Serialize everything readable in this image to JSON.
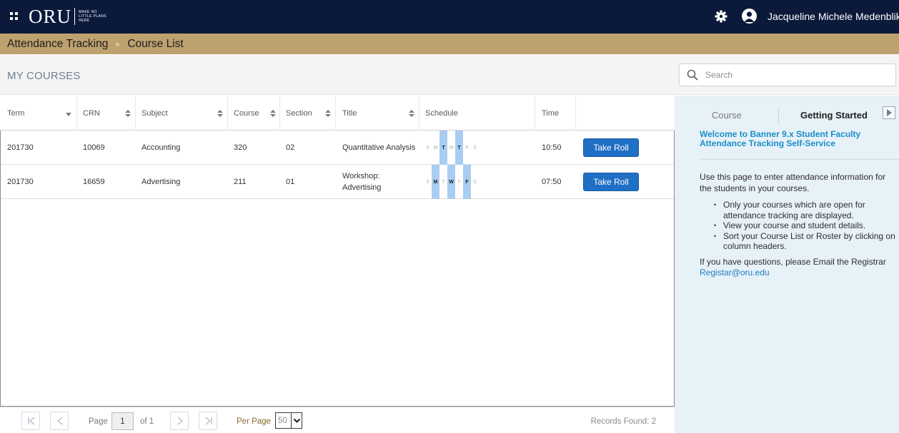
{
  "header": {
    "logo_text": "ORU",
    "logo_tagline": "MAKE NO LITTLE PLANS HERE",
    "user_name": "Jacqueline Michele Medenblik"
  },
  "breadcrumb": {
    "items": [
      "Attendance Tracking",
      "Course List"
    ]
  },
  "main": {
    "title": "MY COURSES"
  },
  "search": {
    "placeholder": "Search"
  },
  "table": {
    "columns": [
      "Term",
      "CRN",
      "Subject",
      "Course",
      "Section",
      "Title",
      "Schedule",
      "Time"
    ],
    "rows": [
      {
        "term": "201730",
        "crn": "10069",
        "subject": "Accounting",
        "course": "320",
        "section": "02",
        "title": "Quantitative Analysis",
        "time": "10:50",
        "action": "Take Roll",
        "days": [
          {
            "label": "S",
            "on": false
          },
          {
            "label": "M",
            "on": false
          },
          {
            "label": "T",
            "on": true
          },
          {
            "label": "W",
            "on": false
          },
          {
            "label": "T",
            "on": true
          },
          {
            "label": "F",
            "on": false
          },
          {
            "label": "S",
            "on": false
          }
        ]
      },
      {
        "term": "201730",
        "crn": "16659",
        "subject": "Advertising",
        "course": "211",
        "section": "01",
        "title_line1": "Workshop:",
        "title_line2": "Advertising",
        "time": "07:50",
        "action": "Take Roll",
        "days": [
          {
            "label": "S",
            "on": false
          },
          {
            "label": "M",
            "on": true
          },
          {
            "label": "T",
            "on": false
          },
          {
            "label": "W",
            "on": true
          },
          {
            "label": "T",
            "on": false
          },
          {
            "label": "F",
            "on": true
          },
          {
            "label": "S",
            "on": false
          }
        ]
      }
    ]
  },
  "pagination": {
    "page_label": "Page",
    "page_value": "1",
    "of_label": "of 1",
    "per_page_label": "Per Page",
    "per_page_value": "50",
    "records_found": "Records Found: 2"
  },
  "side_panel": {
    "tabs": [
      "Course",
      "Getting Started"
    ],
    "welcome": "Welcome to Banner 9.x Student Faculty Attendance Tracking Self-Service",
    "intro": "Use this page to enter attendance information for the students in your courses.",
    "bullets": [
      "Only your courses which are open for attendance tracking are displayed.",
      "View your course and student details.",
      "Sort your Course List or Roster by clicking on column headers."
    ],
    "question": "If you have questions, please Email the Registrar",
    "email": "Registar@oru.edu"
  },
  "colors": {
    "topbar": "#0b1a3b",
    "breadcrumb": "#bda16e",
    "button": "#1f6fc5",
    "schedule_highlight": "#a9cdf1",
    "side_panel": "#e7f1f8",
    "link": "#1a8fc8"
  }
}
